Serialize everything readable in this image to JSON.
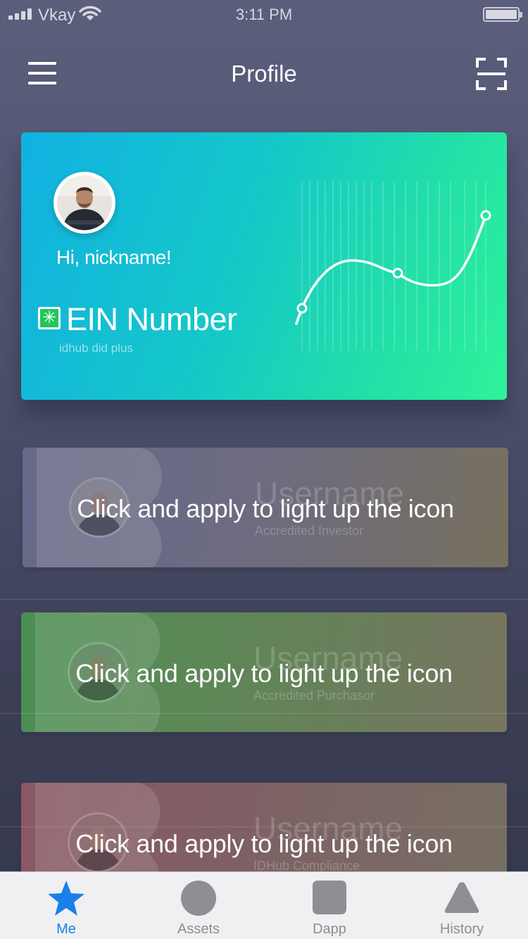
{
  "status_bar": {
    "carrier": "Vkay",
    "time": "3:11 PM"
  },
  "header": {
    "title": "Profile"
  },
  "profile_card": {
    "greeting": "Hi, nickname!",
    "ein_title": "EIN Number",
    "ein_subtitle": "idhub did plus"
  },
  "credentials": [
    {
      "username": "Username",
      "role": "Accredited Investor",
      "cta": "Click and apply to light up the icon"
    },
    {
      "username": "Username",
      "role": "Accredited Purchasor",
      "cta": "Click and apply to light up the icon"
    },
    {
      "username": "Username",
      "role": "IDHub Compliance",
      "cta": "Click and apply to light up the icon"
    }
  ],
  "tabs": [
    {
      "label": "Me",
      "icon": "star-icon",
      "active": true
    },
    {
      "label": "Assets",
      "icon": "circle-icon",
      "active": false
    },
    {
      "label": "Dapp",
      "icon": "square-icon",
      "active": false
    },
    {
      "label": "History",
      "icon": "triangle-icon",
      "active": false
    }
  ],
  "colors": {
    "accent": "#1a7fe8",
    "card_gradient_start": "#11b1e2",
    "card_gradient_end": "#2ff29a",
    "ein_badge": "#23c65a",
    "tab_inactive": "#8e8e93"
  }
}
